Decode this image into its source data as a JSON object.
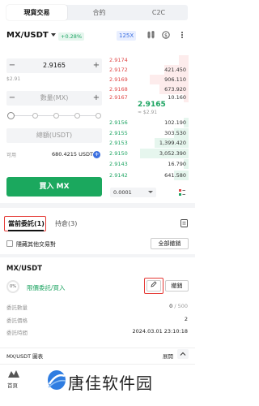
{
  "top_tabs": [
    "現貨交易",
    "合約",
    "C2C"
  ],
  "header": {
    "pair": "MX/USDT",
    "change": "+0.28%",
    "leverage": "125X",
    "icons": [
      "kline-icon",
      "dollar-circle-icon",
      "more-icon"
    ]
  },
  "form": {
    "price": "2.9165",
    "price_usd": "$2.91",
    "amount_placeholder": "數量(MX)",
    "total_placeholder": "總額(USDT)",
    "available_label": "可用",
    "available_value": "680.4215 USDT",
    "buy_button": "買入 MX"
  },
  "orderbook": {
    "asks": [
      {
        "p": "2.9174",
        "q": "",
        "fill": 0.2
      },
      {
        "p": "2.9172",
        "q": "421.450",
        "fill": 0.5
      },
      {
        "p": "2.9169",
        "q": "906.110",
        "fill": 0.8
      },
      {
        "p": "2.9168",
        "q": "673.920",
        "fill": 0.6
      },
      {
        "p": "2.9167",
        "q": "10.160",
        "fill": 0.1
      }
    ],
    "mid_price": "2.9165",
    "mid_usd": "≈ $2.91",
    "bids": [
      {
        "p": "2.9156",
        "q": "102.190",
        "fill": 0.1
      },
      {
        "p": "2.9155",
        "q": "303.530",
        "fill": 0.3
      },
      {
        "p": "2.9153",
        "q": "1,399.420",
        "fill": 0.7
      },
      {
        "p": "2.9150",
        "q": "3,052.390",
        "fill": 1.0
      },
      {
        "p": "2.9143",
        "q": "16.790",
        "fill": 0.1
      },
      {
        "p": "2.9142",
        "q": "641.580",
        "fill": 0.3
      }
    ],
    "precision": "0.0001"
  },
  "orders": {
    "tab_current": "當前委託(1)",
    "tab_positions": "持倉(3)",
    "hide_other_label": "隱藏其他交易對",
    "cancel_all": "全部撤銷",
    "pair": "MX/USDT",
    "progress": "0%",
    "type": "限價委託/買入",
    "cancel": "撤銷",
    "rows": [
      {
        "k": "委託數量",
        "v": "0",
        "v2": " / 500"
      },
      {
        "k": "委託價格",
        "v": "2",
        "v2": ""
      },
      {
        "k": "委託時間",
        "v": "2024.03.01 23:10:18",
        "v2": ""
      }
    ]
  },
  "chart_bar": {
    "label": "MX/USDT 圖表",
    "expand": "展開"
  },
  "bottom_nav": {
    "home": "首頁"
  },
  "watermark": "唐佳软件园",
  "colors": {
    "green": "#1ba85e",
    "red": "#e04747",
    "blue": "#3b6fe0"
  }
}
